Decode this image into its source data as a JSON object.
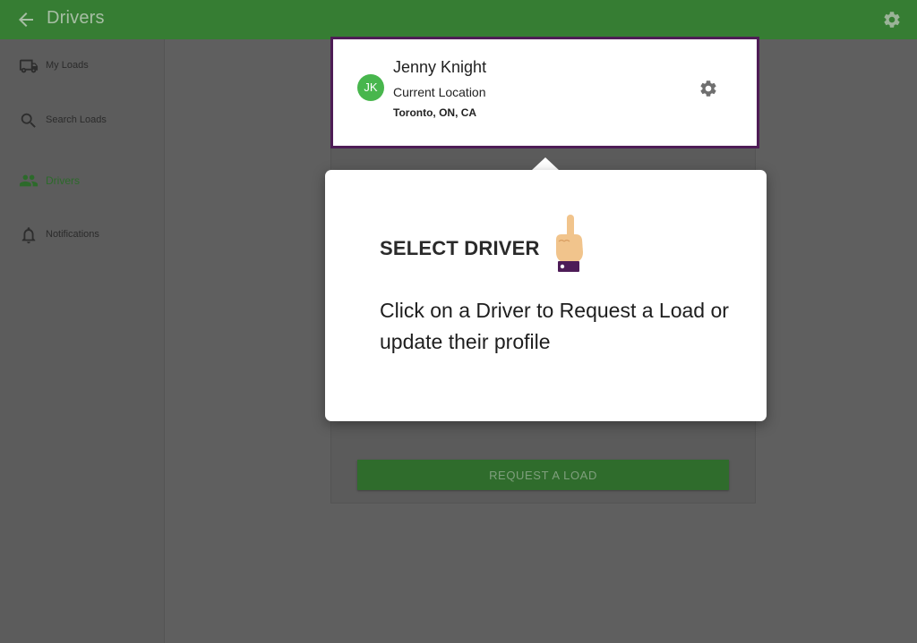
{
  "appbar": {
    "title": "Drivers",
    "back_icon": "arrow-left-icon",
    "settings_icon": "gear-icon"
  },
  "sidebar": {
    "items": [
      {
        "label": "My Loads",
        "icon": "truck-icon"
      },
      {
        "label": "Search Loads",
        "icon": "search-icon"
      },
      {
        "label": "Drivers",
        "icon": "people-icon",
        "active": true
      },
      {
        "label": "Notifications",
        "icon": "bell-icon"
      }
    ]
  },
  "driver": {
    "initials": "JK",
    "name": "Jenny Knight",
    "location_label": "Current Location",
    "location": "Toronto, ON, CA"
  },
  "card": {
    "request_button": "REQUEST A LOAD"
  },
  "tooltip": {
    "title": "SELECT DRIVER",
    "emoji": "pointing-up-hand",
    "body": "Click on a Driver to Request a Load or update their profile"
  },
  "colors": {
    "brand_green": "#367d33",
    "highlight_border": "#4e1d56",
    "avatar_green": "#48b64d"
  }
}
